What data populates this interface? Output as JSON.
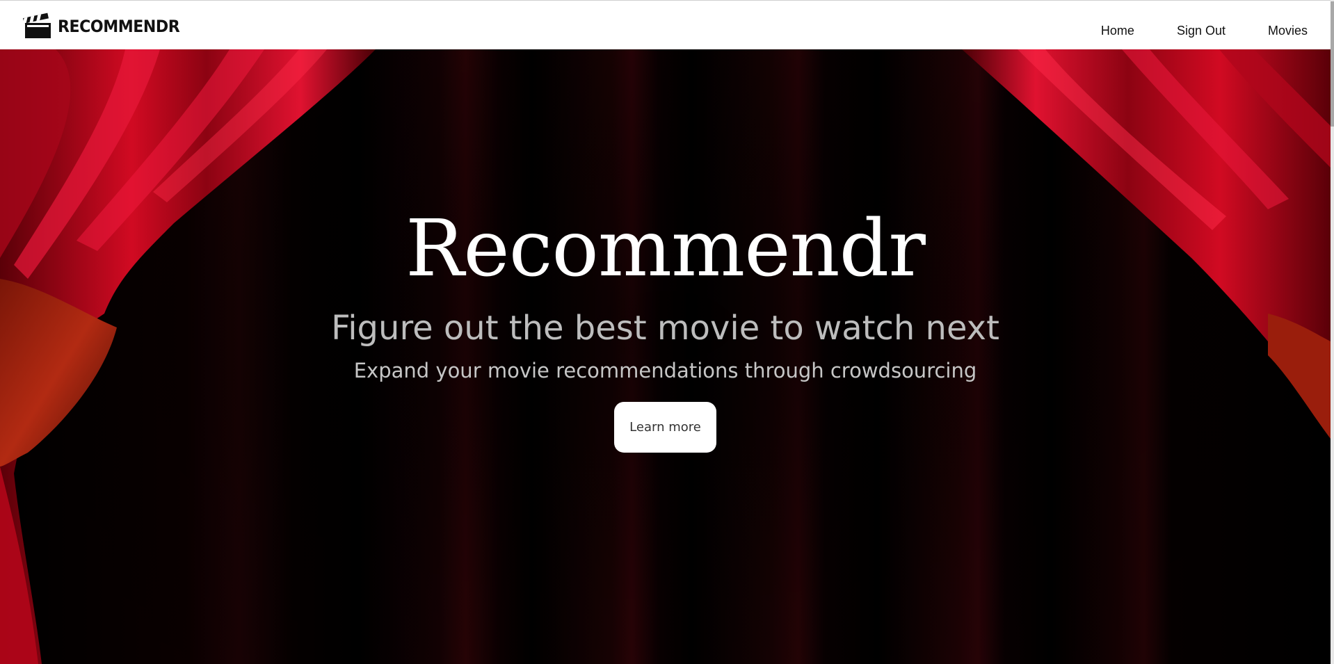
{
  "navbar": {
    "brand": "RECOMMENDR",
    "brand_icon": "clapperboard-icon",
    "links": [
      {
        "label": "Home"
      },
      {
        "label": "Sign Out"
      },
      {
        "label": "Movies"
      }
    ]
  },
  "hero": {
    "title": "Recommendr",
    "subtitle": "Figure out the best movie to watch next",
    "tagline": "Expand your movie recommendations through crowdsourcing",
    "cta_label": "Learn more",
    "background": "red-theater-curtain-image"
  },
  "colors": {
    "navbar_bg": "#ffffff",
    "hero_bg": "#000000",
    "curtain_red": "#c4081e",
    "title_color": "#ffffff",
    "subtitle_color": "#bdbdbd"
  }
}
